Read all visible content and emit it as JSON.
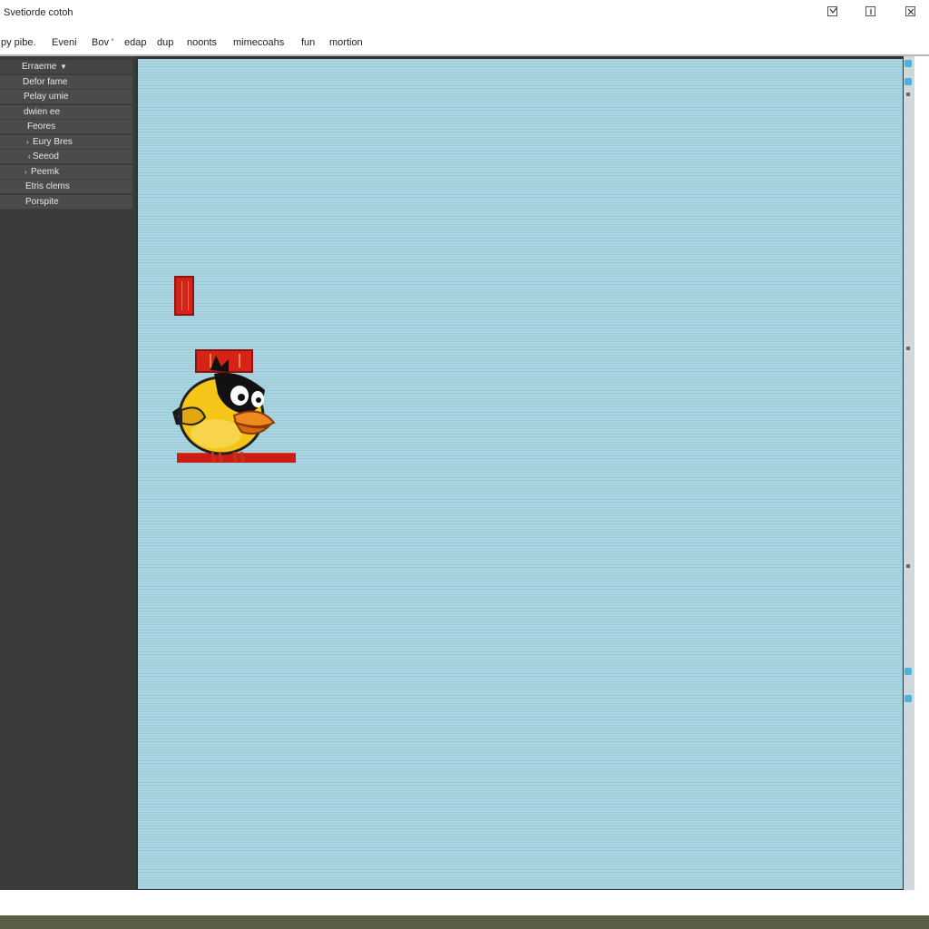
{
  "window": {
    "title": "Svetiorde cotoh"
  },
  "menu": {
    "items": [
      "py pibe.",
      "Eveni",
      "Bov '",
      "edap",
      "dup",
      "noonts",
      "mimecoahs",
      "fun",
      "mortion"
    ]
  },
  "sidebar": {
    "header": "Erraeme",
    "items": [
      {
        "label": "Defor fame"
      },
      {
        "label": "Pelay umie"
      },
      {
        "label": "dwien ee"
      },
      {
        "label": "Feores"
      },
      {
        "label": "Eury Bres",
        "chevron": "›"
      },
      {
        "label": "Seeod",
        "chevron": "‹"
      },
      {
        "label": "Peemk",
        "chevron": "›"
      },
      {
        "label": "Etris clems"
      },
      {
        "label": "Porspite"
      }
    ]
  },
  "icons": {
    "window_controls": [
      "minimize-icon",
      "maximize-icon",
      "close-icon"
    ],
    "chevron": "chevron-down-icon",
    "sprite": "yellow-bird-sprite"
  },
  "colors": {
    "sky": "#a9d5e0",
    "sidebar": "#3a3c3a",
    "brick_red": "#d42418",
    "bird_yellow": "#f5c518",
    "scroll_accent": "#4fb0d8"
  }
}
